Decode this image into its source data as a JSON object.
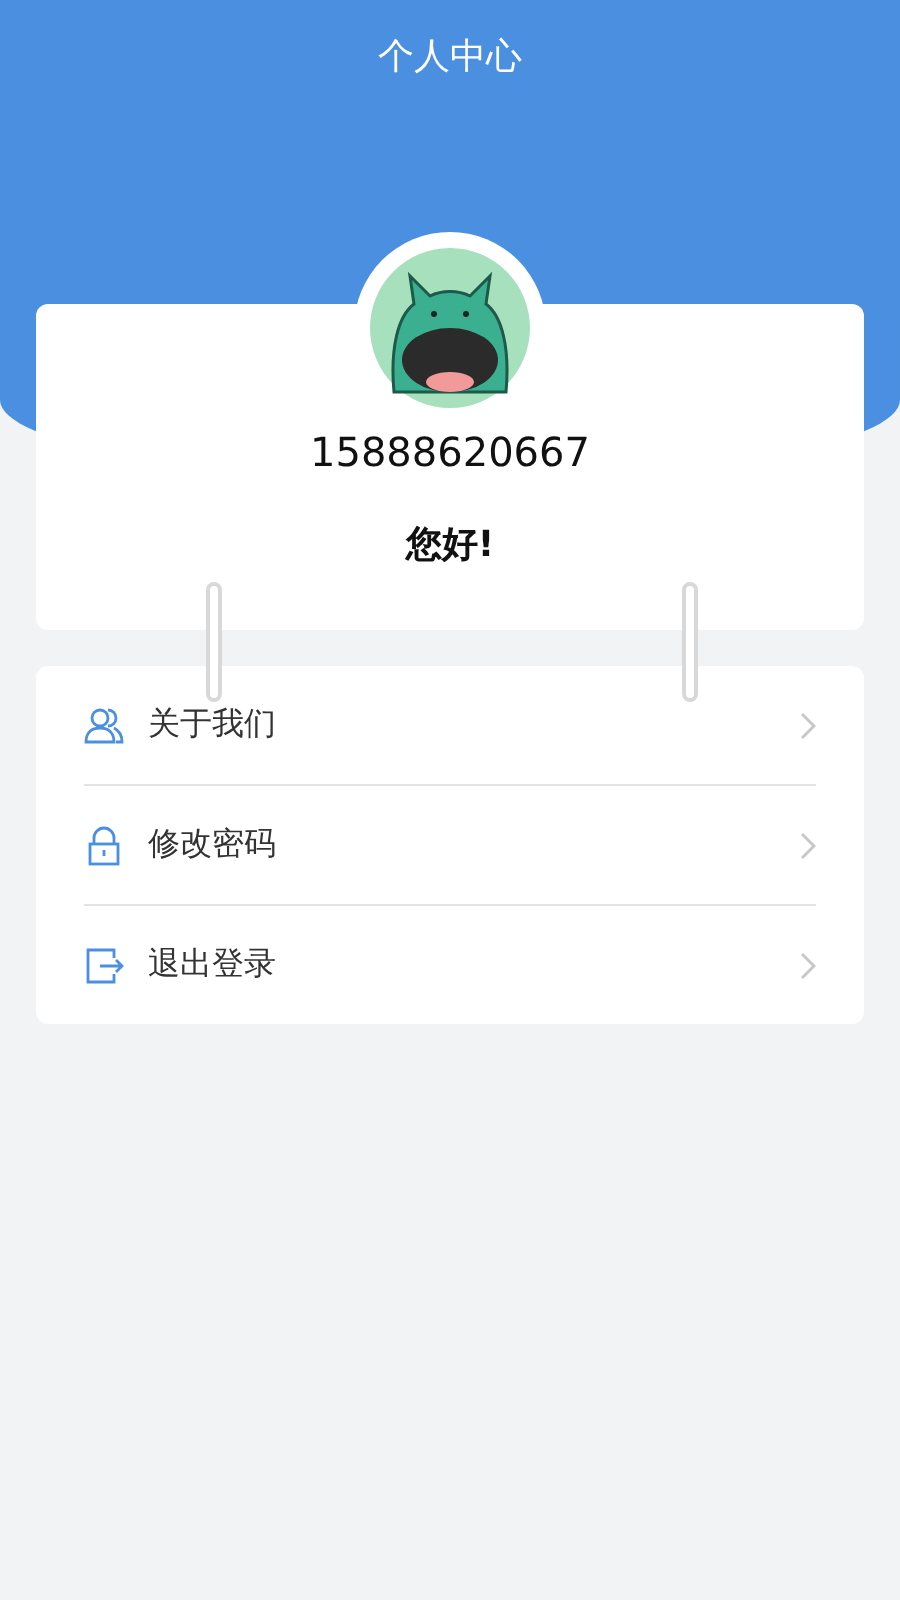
{
  "header": {
    "title": "个人中心"
  },
  "profile": {
    "phone": "15888620667",
    "greeting": "您好!"
  },
  "menu": [
    {
      "kind": "people",
      "label": "关于我们"
    },
    {
      "kind": "lock",
      "label": "修改密码"
    },
    {
      "kind": "logout",
      "label": "退出登录"
    }
  ]
}
